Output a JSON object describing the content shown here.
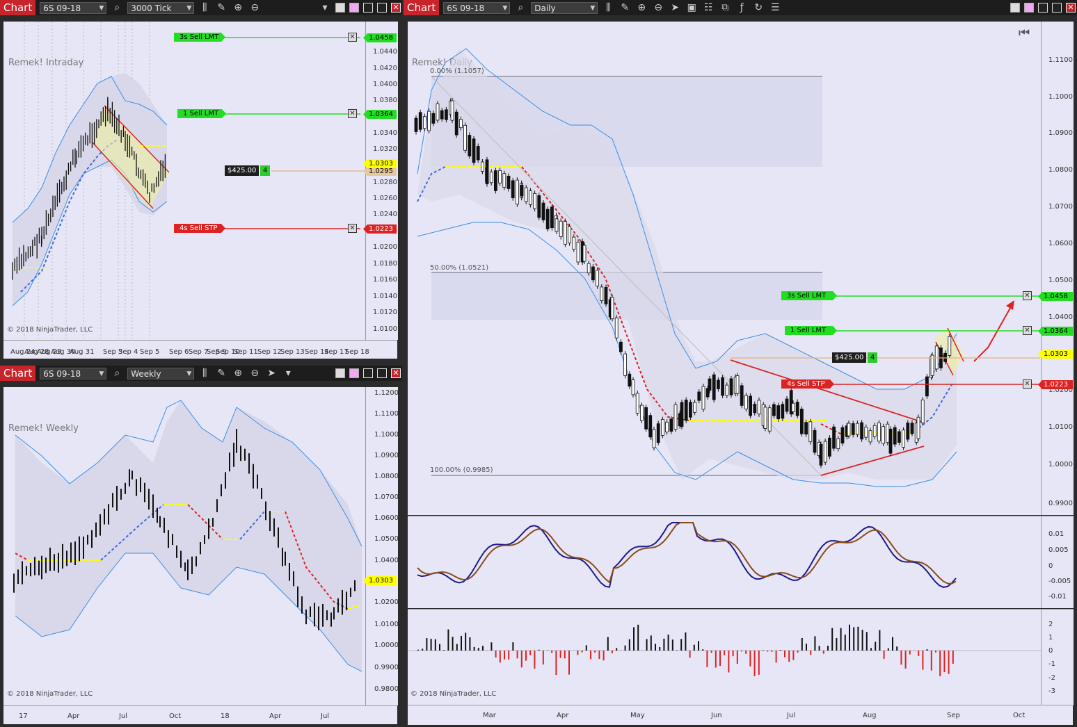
{
  "colors": {
    "pane_bg": "#e6e6f6",
    "buy_green": "#22dd22",
    "sell_red": "#dd2222",
    "last_price_yellow": "#ffff00",
    "band_blue": "#3a8ee6"
  },
  "icons": [
    "search-icon",
    "bar-type-icon",
    "pencil-icon",
    "zoom-in-icon",
    "zoom-out-icon",
    "cursor-icon",
    "dropdown-arrow-icon",
    "data-box-icon",
    "template-icon",
    "scale-icon",
    "indicator-icon",
    "refresh-icon",
    "properties-icon",
    "restore-icon",
    "close-icon"
  ],
  "windows": {
    "intraday": {
      "title": "Chart",
      "instrument": "6S 09-18",
      "interval": "3000 Tick",
      "watermark": "Remek! Intraday",
      "copyright": "© 2018 NinjaTrader, LLC",
      "price_ticks": [
        "1.0440",
        "1.0420",
        "1.0400",
        "1.0380",
        "1.0360",
        "1.0340",
        "1.0320",
        "1.0280",
        "1.0260",
        "1.0240",
        "1.0220",
        "1.0200",
        "1.0180",
        "1.0160",
        "1.0140",
        "1.0120",
        "1.0100"
      ],
      "time_ticks": [
        "Aug 24",
        "Aug 28",
        "Aug 29",
        "Aug 30",
        "Aug 31",
        "Sep 3",
        "Sep 4",
        "Sep 5",
        "Sep 6",
        "Sep 7",
        "Sep 9",
        "Sep 10",
        "Sep 11",
        "Sep 12",
        "Sep 13",
        "Sep 14",
        "Sep 17",
        "Sep 18"
      ],
      "orders": [
        {
          "label": "3s  Sell LMT",
          "price": "1.0458",
          "type": "buy"
        },
        {
          "label": "1  Sell LMT",
          "price": "1.0364",
          "type": "buy"
        },
        {
          "label": "4s  Sell STP",
          "price": "1.0223",
          "type": "sell"
        }
      ],
      "position": {
        "pnl": "$425.00",
        "qty": "4"
      },
      "last_price": "1.0303",
      "avg_price": "1.0295"
    },
    "weekly": {
      "title": "Chart",
      "instrument": "6S 09-18",
      "interval": "Weekly",
      "watermark": "Remek! Weekly",
      "copyright": "© 2018 NinjaTrader, LLC",
      "price_ticks": [
        "1.1200",
        "1.1100",
        "1.1000",
        "1.0900",
        "1.0800",
        "1.0700",
        "1.0600",
        "1.0500",
        "1.0400",
        "1.0200",
        "1.0100",
        "1.0000",
        "0.9900",
        "0.9800"
      ],
      "time_ticks": [
        "17",
        "Apr",
        "Jul",
        "Oct",
        "18",
        "Apr",
        "Jul"
      ],
      "last_price": "1.0303"
    },
    "daily": {
      "title": "Chart",
      "instrument": "6S 09-18",
      "interval": "Daily",
      "watermark": "Remek! Daily",
      "copyright": "© 2018 NinjaTrader, LLC",
      "price_ticks": [
        "1.1100",
        "1.1000",
        "1.0900",
        "1.0800",
        "1.0700",
        "1.0600",
        "1.0500",
        "1.0400",
        "1.0200",
        "1.0100",
        "1.0000",
        "0.9900"
      ],
      "osc_ticks": [
        "0.01",
        "0.005",
        "0",
        "-0.005",
        "-0.01"
      ],
      "hist_ticks": [
        "2",
        "1",
        "0",
        "-1",
        "-2",
        "-3"
      ],
      "time_ticks": [
        "Mar",
        "Apr",
        "May",
        "Jun",
        "Jul",
        "Aug",
        "Sep",
        "Oct"
      ],
      "fib": [
        {
          "label": "0.00% (1.1057)"
        },
        {
          "label": "50.00% (1.0521)"
        },
        {
          "label": "100.00% (0.9985)"
        }
      ],
      "orders": [
        {
          "label": "3s  Sell LMT",
          "price": "1.0458",
          "type": "buy"
        },
        {
          "label": "1  Sell LMT",
          "price": "1.0364",
          "type": "buy"
        },
        {
          "label": "4s  Sell STP",
          "price": "1.0223",
          "type": "sell"
        }
      ],
      "position": {
        "pnl": "$425.00",
        "qty": "4"
      },
      "last_price": "1.0303"
    }
  }
}
